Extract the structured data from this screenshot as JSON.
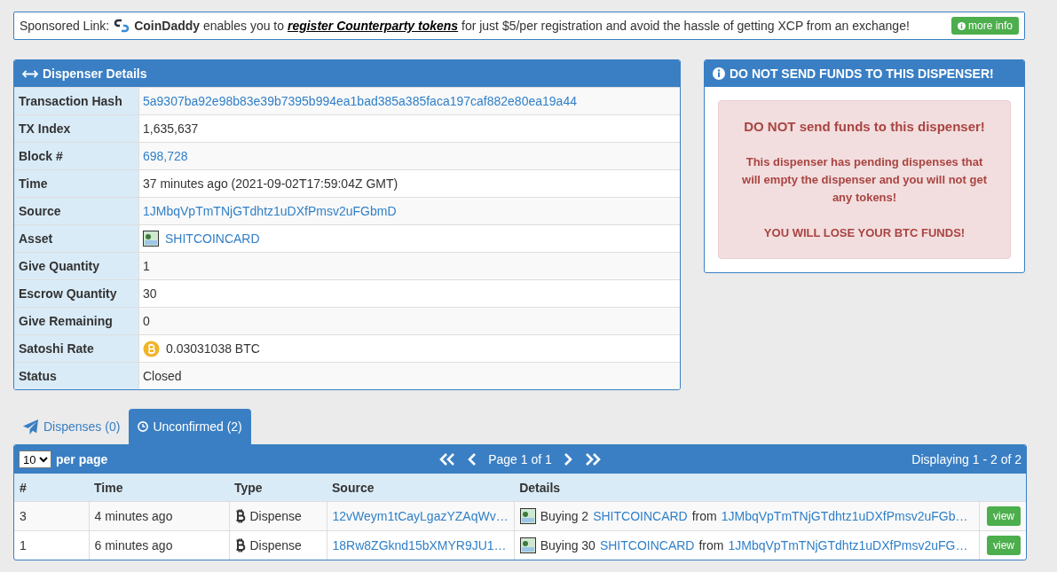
{
  "sponsor": {
    "label": "Sponsored Link:",
    "lead": "**CoinDaddy** enables you to ",
    "link": "register Counterparty tokens",
    "tail": " for just $5/per registration and avoid the hassle of getting XCP from an exchange!",
    "button": "more info"
  },
  "details": {
    "title": "Dispenser Details",
    "rows": [
      {
        "label": "Transaction Hash",
        "kind": "link",
        "value": "5a9307ba92e98b83e39b7395b994ea1bad385a385faca197caf882e80ea19a44"
      },
      {
        "label": "TX Index",
        "kind": "text",
        "value": "1,635,637"
      },
      {
        "label": "Block #",
        "kind": "link",
        "value": "698,728"
      },
      {
        "label": "Time",
        "kind": "text",
        "value": "37 minutes ago (2021-09-02T17:59:04Z GMT)"
      },
      {
        "label": "Source",
        "kind": "link",
        "value": "1JMbqVpTmTNjGTdhtz1uDXfPmsv2uFGbmD"
      },
      {
        "label": "Asset",
        "kind": "asset",
        "value": "SHITCOINCARD"
      },
      {
        "label": "Give Quantity",
        "kind": "text",
        "value": "1"
      },
      {
        "label": "Escrow Quantity",
        "kind": "text",
        "value": "30"
      },
      {
        "label": "Give Remaining",
        "kind": "text",
        "value": "0"
      },
      {
        "label": "Satoshi Rate",
        "kind": "btc",
        "value": "0.03031038 BTC"
      },
      {
        "label": "Status",
        "kind": "text",
        "value": "Closed"
      }
    ]
  },
  "warning": {
    "title": "DO NOT SEND FUNDS TO THIS DISPENSER!",
    "lines": [
      "DO NOT send funds to this dispenser!",
      "This dispenser has pending dispenses that will empty the dispenser and you will not get any tokens!",
      "YOU WILL LOSE YOUR BTC FUNDS!"
    ]
  },
  "tabs": [
    {
      "label": "Dispenses (0)",
      "selected": false
    },
    {
      "label": "Unconfirmed (2)",
      "selected": true
    }
  ],
  "pager": {
    "page_size": "10",
    "per_page": "per page",
    "page": "Page 1 of 1",
    "displaying": "Displaying 1 - 2 of 2"
  },
  "table": {
    "columns": [
      "#",
      "Time",
      "Type",
      "Source",
      "Details"
    ],
    "rows": [
      {
        "index": "3",
        "time": "4 minutes ago",
        "type": "Dispense",
        "source": "12vWeym1tCayLgazYZAqWv…",
        "action": "Buying 2",
        "asset": "SHITCOINCARD",
        "from": "from",
        "address": "1JMbqVpTmTNjGTdhtz1uDXfPmsv2uFGb…",
        "button": "view"
      },
      {
        "index": "1",
        "time": "6 minutes ago",
        "type": "Dispense",
        "source": "18Rw8ZGknd15bXMYR9JU1…",
        "action": "Buying 30",
        "asset": "SHITCOINCARD",
        "from": "from",
        "address": "1JMbqVpTmTNjGTdhtz1uDXfPmsv2uFG…",
        "button": "view"
      }
    ]
  }
}
